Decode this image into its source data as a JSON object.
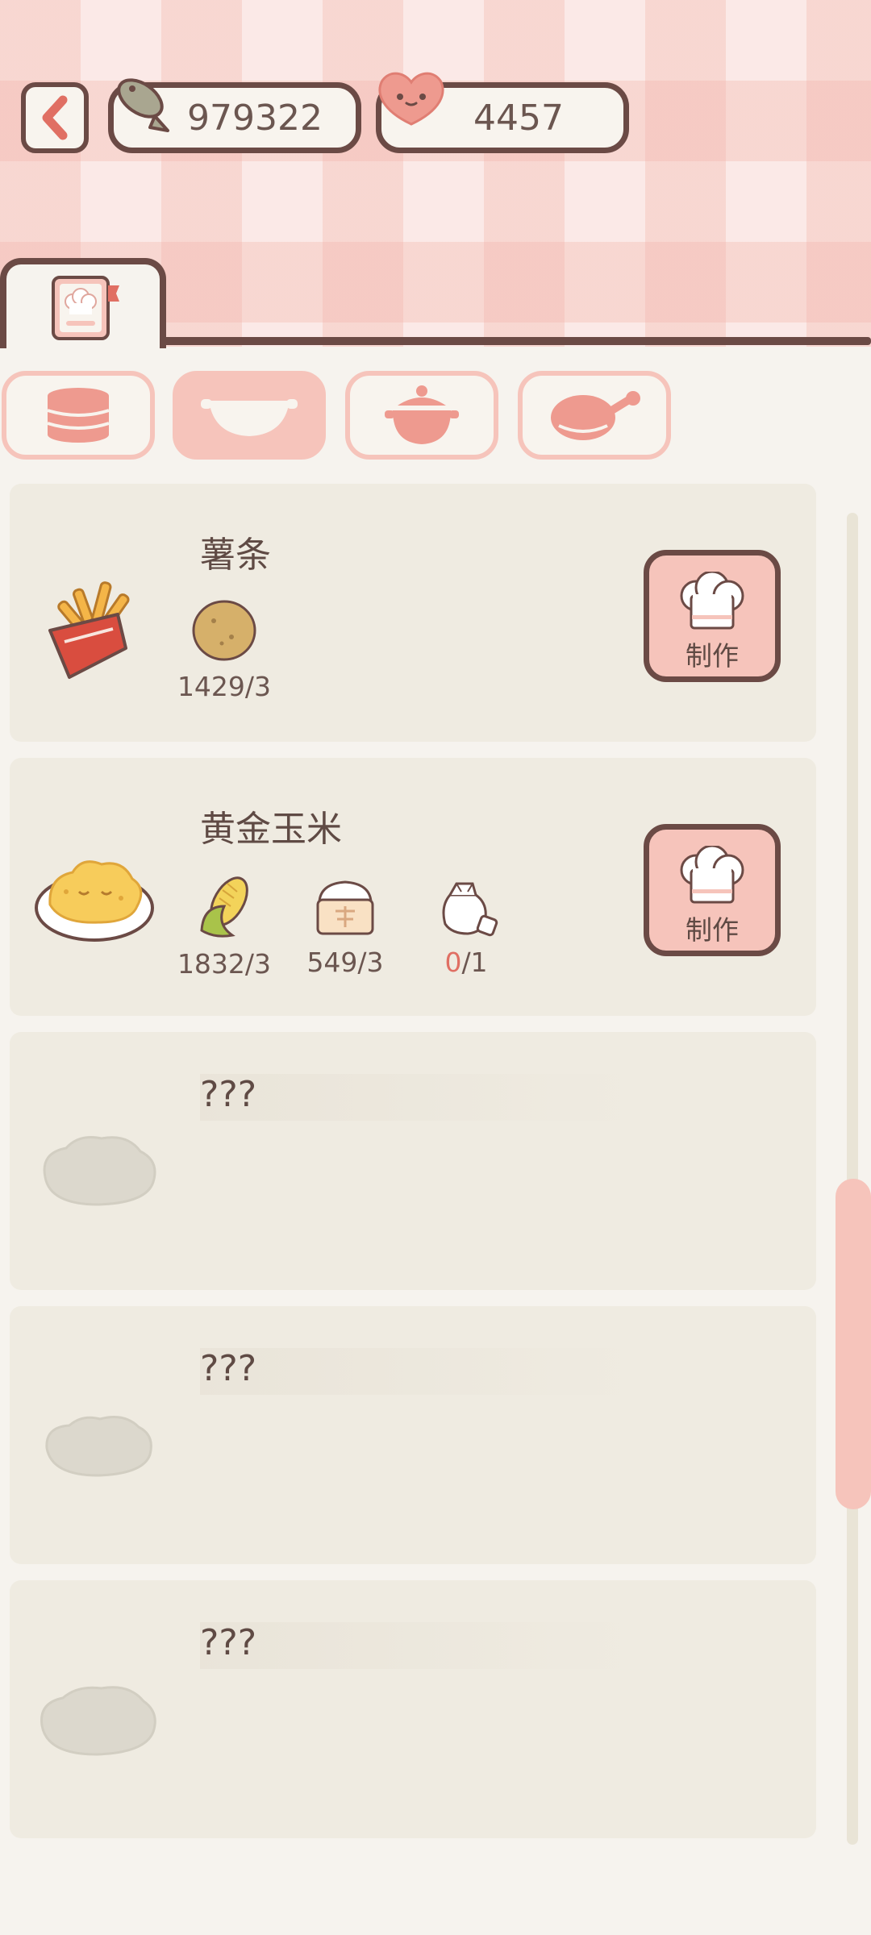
{
  "currency": {
    "fish_amount": "979322",
    "heart_amount": "4457"
  },
  "colors": {
    "accent": "#f6c4bb",
    "outline": "#6b4a45",
    "card_bg": "#efebe1",
    "shortage_red": "#e06f63"
  },
  "categories": [
    {
      "icon": "steamer-icon",
      "active": false
    },
    {
      "icon": "bowl-icon",
      "active": true
    },
    {
      "icon": "clay-pot-icon",
      "active": false
    },
    {
      "icon": "frying-pan-icon",
      "active": false
    }
  ],
  "recipes": [
    {
      "name": "薯条",
      "dish_icon": "french-fries-icon",
      "ingredients": [
        {
          "icon": "potato-icon",
          "count": "1429/3"
        }
      ],
      "button_label": "制作"
    },
    {
      "name": "黄金玉米",
      "dish_icon": "golden-corn-dish-icon",
      "ingredients": [
        {
          "icon": "corn-icon",
          "count": "1832/3"
        },
        {
          "icon": "flour-icon",
          "count": "549/3"
        },
        {
          "icon": "sugar-jar-icon",
          "have": "0",
          "need": "/1"
        }
      ],
      "button_label": "制作"
    },
    {
      "name": "???",
      "locked": true
    },
    {
      "name": "???",
      "locked": true
    },
    {
      "name": "???",
      "locked": true
    }
  ]
}
